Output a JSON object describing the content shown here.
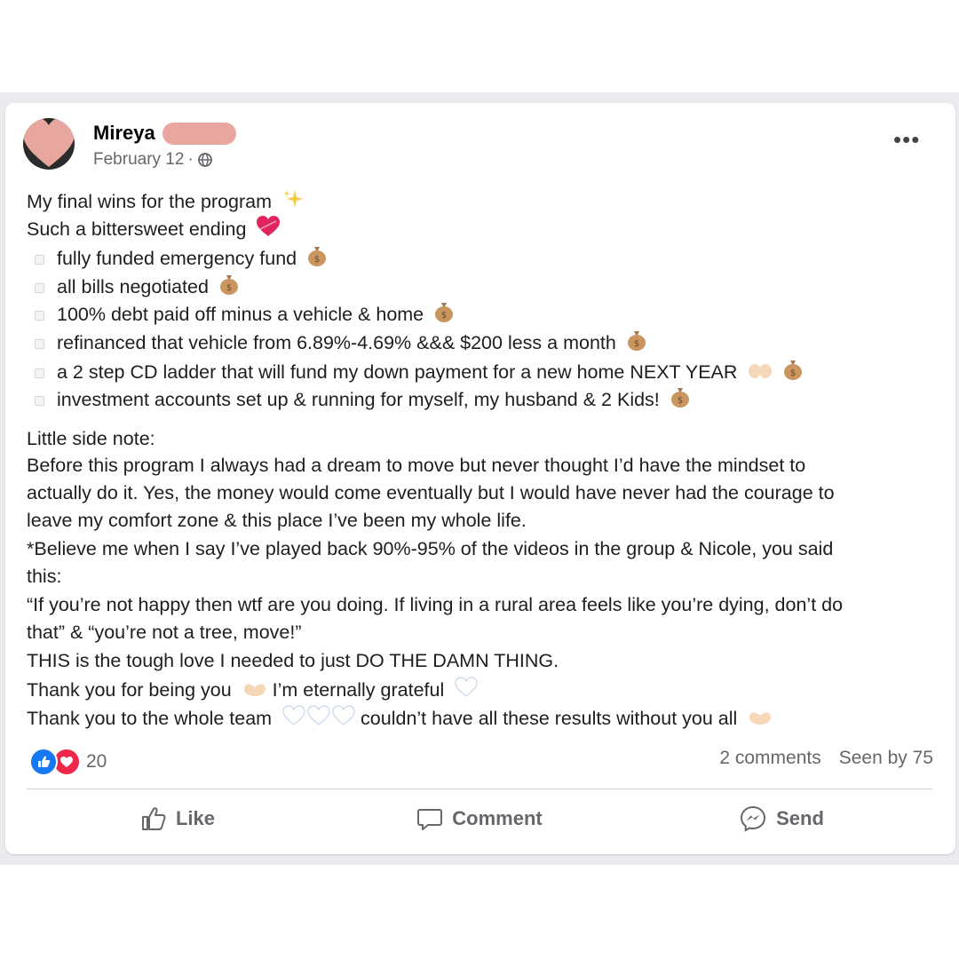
{
  "post": {
    "author": "Mireya",
    "date": "February 12",
    "separator": "·",
    "more_label": "•••",
    "intro": [
      "My final wins for the program",
      "Such a bittersweet ending"
    ],
    "wins": [
      "fully funded emergency fund",
      "all bills negotiated",
      "100% debt paid off minus a vehicle & home",
      "refinanced that vehicle from 6.89%-4.69% &&& $200 less a month",
      "a 2 step CD ladder that will fund my down payment for a new home NEXT YEAR",
      "investment accounts set up & running for myself, my husband & 2 Kids!"
    ],
    "note_lines": [
      "Little side note:",
      "Before this program I always had a dream to move but never thought I’d have the mindset to",
      "actually do it. Yes, the money would come eventually but I would have never had the courage to",
      "leave my comfort zone & this place I’ve been my whole life.",
      "*Believe me when I say I’ve played back 90%-95% of the videos in the group & Nicole, you said",
      "this:",
      "“If you’re not happy then wtf are you doing. If living in a rural area feels like you’re dying, don’t do",
      "that” & “you’re not a tree, move!”",
      "THIS is the tough love I needed to just DO THE DAMN THING."
    ],
    "thanks_1": {
      "a": "Thank you for being you",
      "b": "I’m eternally grateful"
    },
    "thanks_2": {
      "a": "Thank you to the whole team",
      "b": "couldn’t have all these results without you all"
    }
  },
  "footer": {
    "reaction_count": "20",
    "comments": "2 comments",
    "seen_by": "Seen by 75",
    "like_label": "Like",
    "comment_label": "Comment",
    "send_label": "Send"
  },
  "colors": {
    "accent": "#1877f2",
    "love": "#f0284a",
    "muted": "#65676b",
    "redaction": "#e8a79e"
  },
  "icons": [
    "globe-icon",
    "sparkles-icon",
    "heart-icon",
    "money-bag-icon",
    "raising-hands-icon",
    "heart-hands-icon",
    "white-heart-icon",
    "like-icon",
    "comment-icon",
    "messenger-icon"
  ]
}
